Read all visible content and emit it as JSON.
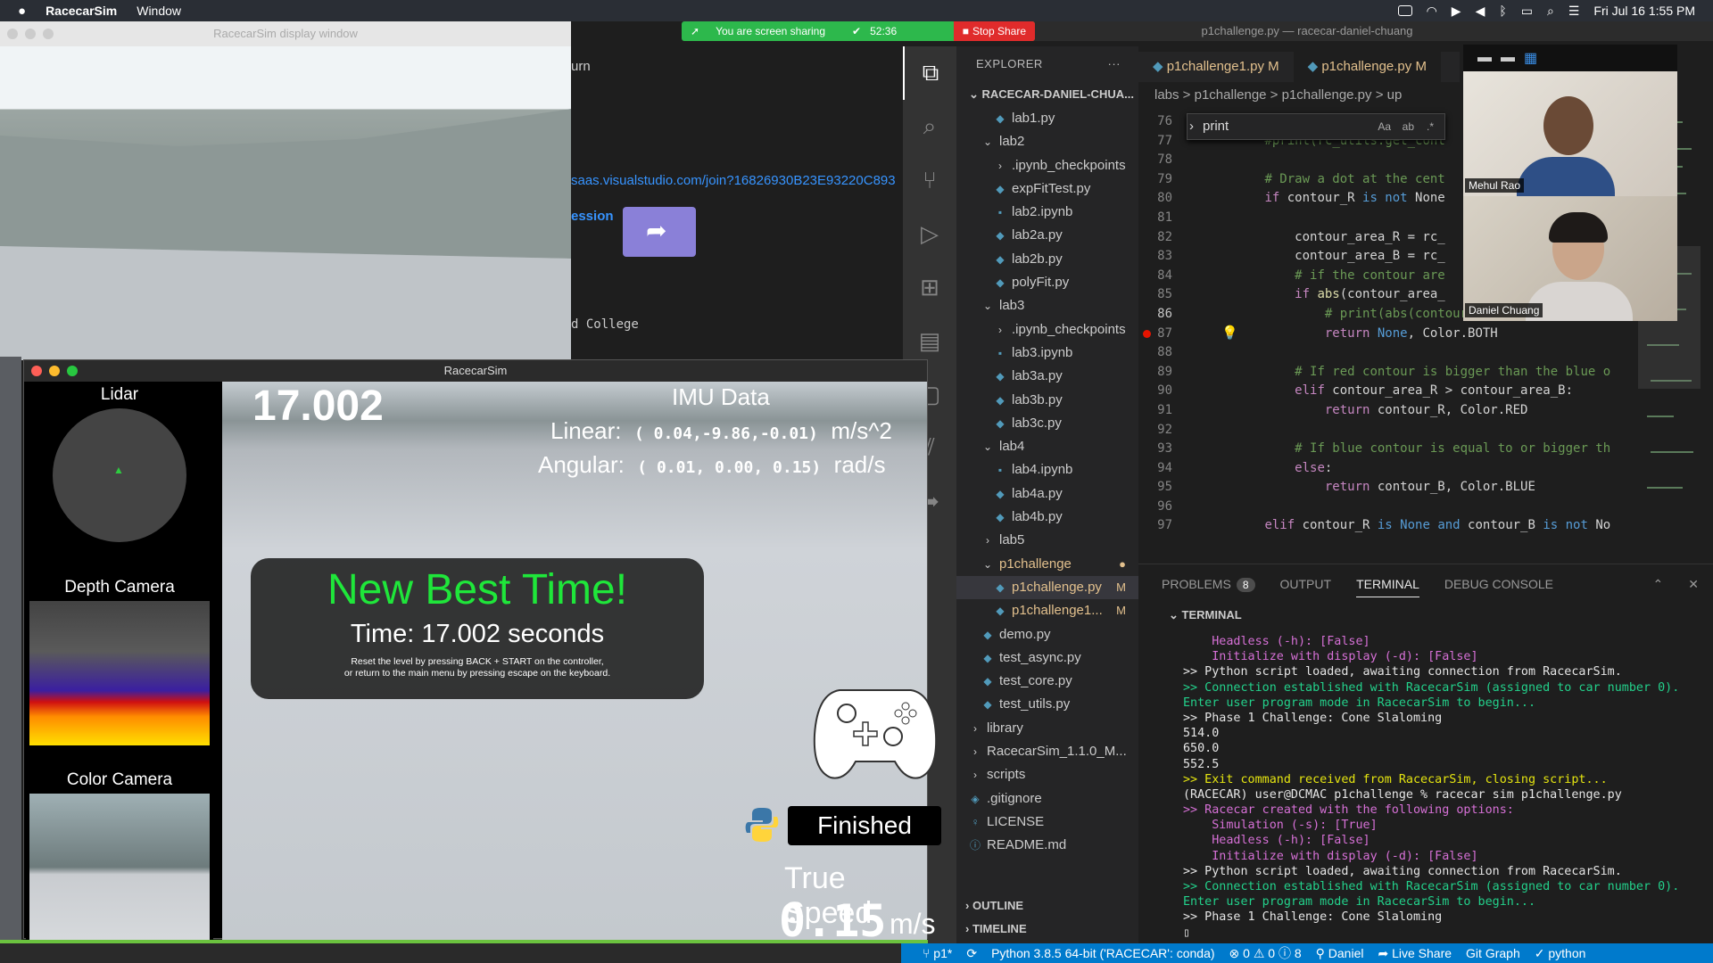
{
  "menubar": {
    "app": "RacecarSim",
    "items": [
      "Window"
    ],
    "battery": "",
    "date": "Fri Jul 16  1:55 PM"
  },
  "sharebar": {
    "text": "You are screen sharing",
    "timer": "52:36",
    "stop": "Stop Share"
  },
  "vscode": {
    "title": "p1challenge.py — racecar-daniel-chuang",
    "explorer_header": "EXPLORER",
    "root": "RACECAR-DANIEL-CHUA...",
    "tree": [
      {
        "label": "lab1.py",
        "indent": 2,
        "type": "py"
      },
      {
        "label": "lab2",
        "indent": 1,
        "type": "folder-open"
      },
      {
        "label": ".ipynb_checkpoints",
        "indent": 2,
        "type": "folder"
      },
      {
        "label": "expFitTest.py",
        "indent": 2,
        "type": "py"
      },
      {
        "label": "lab2.ipynb",
        "indent": 2,
        "type": "nb"
      },
      {
        "label": "lab2a.py",
        "indent": 2,
        "type": "py"
      },
      {
        "label": "lab2b.py",
        "indent": 2,
        "type": "py"
      },
      {
        "label": "polyFit.py",
        "indent": 2,
        "type": "py"
      },
      {
        "label": "lab3",
        "indent": 1,
        "type": "folder-open"
      },
      {
        "label": ".ipynb_checkpoints",
        "indent": 2,
        "type": "folder"
      },
      {
        "label": "lab3.ipynb",
        "indent": 2,
        "type": "nb"
      },
      {
        "label": "lab3a.py",
        "indent": 2,
        "type": "py"
      },
      {
        "label": "lab3b.py",
        "indent": 2,
        "type": "py"
      },
      {
        "label": "lab3c.py",
        "indent": 2,
        "type": "py"
      },
      {
        "label": "lab4",
        "indent": 1,
        "type": "folder-open"
      },
      {
        "label": "lab4.ipynb",
        "indent": 2,
        "type": "nb"
      },
      {
        "label": "lab4a.py",
        "indent": 2,
        "type": "py"
      },
      {
        "label": "lab4b.py",
        "indent": 2,
        "type": "py"
      },
      {
        "label": "lab5",
        "indent": 1,
        "type": "folder"
      },
      {
        "label": "p1challenge",
        "indent": 1,
        "type": "folder-open",
        "mod": "●"
      },
      {
        "label": "p1challenge.py",
        "indent": 2,
        "type": "py",
        "mod": "M",
        "sel": true
      },
      {
        "label": "p1challenge1...",
        "indent": 2,
        "type": "py",
        "mod": "M"
      },
      {
        "label": "demo.py",
        "indent": 1,
        "type": "py"
      },
      {
        "label": "test_async.py",
        "indent": 1,
        "type": "py"
      },
      {
        "label": "test_core.py",
        "indent": 1,
        "type": "py"
      },
      {
        "label": "test_utils.py",
        "indent": 1,
        "type": "py"
      },
      {
        "label": "library",
        "indent": 0,
        "type": "folder"
      },
      {
        "label": "RacecarSim_1.1.0_M...",
        "indent": 0,
        "type": "folder"
      },
      {
        "label": "scripts",
        "indent": 0,
        "type": "folder"
      },
      {
        "label": ".gitignore",
        "indent": 0,
        "type": "git"
      },
      {
        "label": "LICENSE",
        "indent": 0,
        "type": "lic"
      },
      {
        "label": "README.md",
        "indent": 0,
        "type": "info"
      }
    ],
    "outline": "OUTLINE",
    "timeline": "TIMELINE",
    "tabs": [
      {
        "label": "p1challenge1.py",
        "mod": "M"
      },
      {
        "label": "p1challenge.py",
        "mod": "M"
      }
    ],
    "breadcrumb": "labs  >  p1challenge  >  p1challenge.py  >  up",
    "find": "print",
    "gutter": [
      "76",
      "77",
      "78",
      "79",
      "80",
      "81",
      "82",
      "83",
      "84",
      "85",
      "86",
      "87",
      "88",
      "89",
      "90",
      "91",
      "92",
      "93",
      "94",
      "95",
      "96",
      "97"
    ],
    "code": [
      [
        [
          "",
          "        contour_B = rc_utils.ge"
        ]
      ],
      [
        [
          "",
          "        "
        ],
        [
          "cm",
          "#"
        ],
        [
          "cm",
          "print"
        ],
        [
          "cm",
          "(rc_utils.get_cont"
        ]
      ],
      [
        [
          "",
          ""
        ]
      ],
      [
        [
          "",
          "        "
        ],
        [
          "cm",
          "# Draw a dot at the cent"
        ]
      ],
      [
        [
          "",
          "        "
        ],
        [
          "kc",
          "if"
        ],
        [
          "",
          " contour_R "
        ],
        [
          "kw",
          "is not"
        ],
        [
          "",
          " None"
        ]
      ],
      [
        [
          "",
          ""
        ]
      ],
      [
        [
          "",
          "            contour_area_R = rc_"
        ]
      ],
      [
        [
          "",
          "            contour_area_B = rc_"
        ]
      ],
      [
        [
          "",
          "            "
        ],
        [
          "cm",
          "# if the contour are"
        ]
      ],
      [
        [
          "",
          "            "
        ],
        [
          "kc",
          "if"
        ],
        [
          "fn",
          " abs"
        ],
        [
          "",
          "(contour_area_"
        ]
      ],
      [
        [
          "",
          "                "
        ],
        [
          "cm",
          "# print(abs(contour_area_R - contour_a"
        ]
      ],
      [
        [
          "",
          "                "
        ],
        [
          "kc",
          "return"
        ],
        [
          "kw",
          " None"
        ],
        [
          "",
          ", Color.BOTH"
        ]
      ],
      [
        [
          "",
          ""
        ]
      ],
      [
        [
          "",
          "            "
        ],
        [
          "cm",
          "# If red contour is bigger than the blue o"
        ]
      ],
      [
        [
          "",
          "            "
        ],
        [
          "kc",
          "elif"
        ],
        [
          "",
          " contour_area_R > contour_area_B:"
        ]
      ],
      [
        [
          "",
          "                "
        ],
        [
          "kc",
          "return"
        ],
        [
          "",
          " contour_R, Color.RED"
        ]
      ],
      [
        [
          "",
          ""
        ]
      ],
      [
        [
          "",
          "            "
        ],
        [
          "cm",
          "# If blue contour is equal to or bigger th"
        ]
      ],
      [
        [
          "",
          "            "
        ],
        [
          "kc",
          "else"
        ],
        [
          "",
          ":"
        ]
      ],
      [
        [
          "",
          "                "
        ],
        [
          "kc",
          "return"
        ],
        [
          "",
          " contour_B, Color.BLUE"
        ]
      ],
      [
        [
          "",
          ""
        ]
      ],
      [
        [
          "",
          "        "
        ],
        [
          "kc",
          "elif"
        ],
        [
          "",
          " contour_R "
        ],
        [
          "kw",
          "is"
        ],
        [
          "kw",
          " None"
        ],
        [
          "",
          " "
        ],
        [
          "kw",
          "and"
        ],
        [
          "",
          " contour_B "
        ],
        [
          "kw",
          "is not"
        ],
        [
          "",
          " No"
        ]
      ]
    ],
    "panel_tabs": {
      "problems": "PROBLEMS",
      "problems_count": "8",
      "output": "OUTPUT",
      "terminal": "TERMINAL",
      "debug": "DEBUG CONSOLE"
    },
    "terminal_header": "TERMINAL",
    "terminal": [
      [
        "mg",
        "    Headless (-h): [False]"
      ],
      [
        "mg",
        "    Initialize with display (-d): [False]"
      ],
      [
        "wt",
        ">> Python script loaded, awaiting connection from RacecarSim."
      ],
      [
        "gn",
        ">> Connection established with RacecarSim (assigned to car number 0)."
      ],
      [
        "gn",
        "Enter user program mode in RacecarSim to begin..."
      ],
      [
        "wt",
        ">> Phase 1 Challenge: Cone Slaloming"
      ],
      [
        "wt",
        "514.0"
      ],
      [
        "wt",
        "650.0"
      ],
      [
        "wt",
        "552.5"
      ],
      [
        "yl",
        ">> Exit command received from RacecarSim, closing script..."
      ],
      [
        "wt",
        "(RACECAR) user@DCMAC p1challenge % racecar sim p1challenge.py"
      ],
      [
        "mg",
        ">> Racecar created with the following options:"
      ],
      [
        "mg",
        "    Simulation (-s): [True]"
      ],
      [
        "mg",
        "    Headless (-h): [False]"
      ],
      [
        "mg",
        "    Initialize with display (-d): [False]"
      ],
      [
        "wt",
        ">> Python script loaded, awaiting connection from RacecarSim."
      ],
      [
        "gn",
        ">> Connection established with RacecarSim (assigned to car number 0)."
      ],
      [
        "gn",
        "Enter user program mode in RacecarSim to begin..."
      ],
      [
        "wt",
        ">> Phase 1 Challenge: Cone Slaloming"
      ],
      [
        "wt",
        "▯"
      ]
    ],
    "status": [
      "p1*",
      "Python 3.8.5 64-bit ('RACECAR': conda)",
      "⊗ 0 ⚠ 0 ⓘ 8",
      "Daniel",
      "Live Share",
      "Git Graph",
      "python"
    ]
  },
  "video": {
    "person1": "Mehul Rao",
    "person2": "Daniel Chuang"
  },
  "behind": {
    "line1": "urn",
    "link": "saas.visualstudio.com/join?16826930B23E93220C893",
    "session": "ession",
    "college": "d College"
  },
  "display_window": {
    "title": "RacecarSim display window"
  },
  "sim": {
    "title": "RacecarSim",
    "lidar": "Lidar",
    "depth": "Depth Camera",
    "color": "Color Camera",
    "timer": "17.002",
    "imu_title": "IMU Data",
    "linear_label": "Linear:",
    "linear_val": "( 0.04,-9.86,-0.01)",
    "linear_unit": "m/s^2",
    "angular_label": "Angular:",
    "angular_val": "( 0.01, 0.00, 0.15)",
    "angular_unit": "rad/s",
    "best_title": "New Best Time!",
    "best_time": "Time: 17.002 seconds",
    "best_note1": "Reset the level by pressing BACK + START on the controller,",
    "best_note2": "or return to the main menu by pressing escape on the keyboard.",
    "finished": "Finished",
    "speed_label": "True Speed",
    "speed_value": "0.15",
    "speed_unit": "m/s"
  }
}
